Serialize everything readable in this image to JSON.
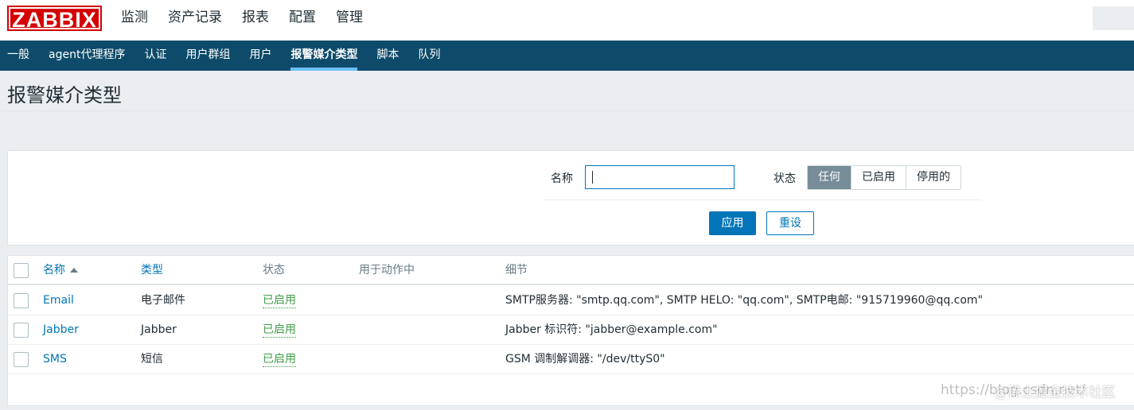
{
  "header": {
    "logo": "ZABBIX",
    "main_nav": [
      {
        "label": "监测"
      },
      {
        "label": "资产记录"
      },
      {
        "label": "报表"
      },
      {
        "label": "配置"
      },
      {
        "label": "管理"
      }
    ],
    "active_main": "管理"
  },
  "subnav": {
    "items": [
      {
        "label": "一般"
      },
      {
        "label": "agent代理程序"
      },
      {
        "label": "认证"
      },
      {
        "label": "用户群组"
      },
      {
        "label": "用户"
      },
      {
        "label": "报警媒介类型"
      },
      {
        "label": "脚本"
      },
      {
        "label": "队列"
      }
    ],
    "active": "报警媒介类型"
  },
  "page": {
    "title": "报警媒介类型"
  },
  "filter": {
    "name_label": "名称",
    "name_value": "",
    "status_label": "状态",
    "status_options": [
      "任何",
      "已启用",
      "停用的"
    ],
    "status_selected": "任何",
    "apply_label": "应用",
    "reset_label": "重设"
  },
  "table": {
    "columns": {
      "name": "名称",
      "type": "类型",
      "status": "状态",
      "used": "用于动作中",
      "details": "细节"
    },
    "sort_column": "名称",
    "sort_direction": "asc",
    "rows": [
      {
        "name": "Email",
        "type": "电子邮件",
        "status": "已启用",
        "used": "",
        "details": "SMTP服务器: \"smtp.qq.com\", SMTP HELO: \"qq.com\", SMTP电邮: \"915719960@qq.com\""
      },
      {
        "name": "Jabber",
        "type": "Jabber",
        "status": "已启用",
        "used": "",
        "details": "Jabber 标识符: \"jabber@example.com\""
      },
      {
        "name": "SMS",
        "type": "短信",
        "status": "已启用",
        "used": "",
        "details": "GSM 调制解调器: \"/dev/ttyS0\""
      }
    ]
  },
  "watermark": {
    "text": "https://blog.csdn.net/",
    "overlay": "@稀土掘金技术社区"
  },
  "colors": {
    "logo_red": "#d40000",
    "subnav_bg": "#0e4b6a",
    "active_underline": "#69c1f7",
    "primary_blue": "#0275b8",
    "enabled_green": "#429e47",
    "selected_segment": "#768d99"
  }
}
